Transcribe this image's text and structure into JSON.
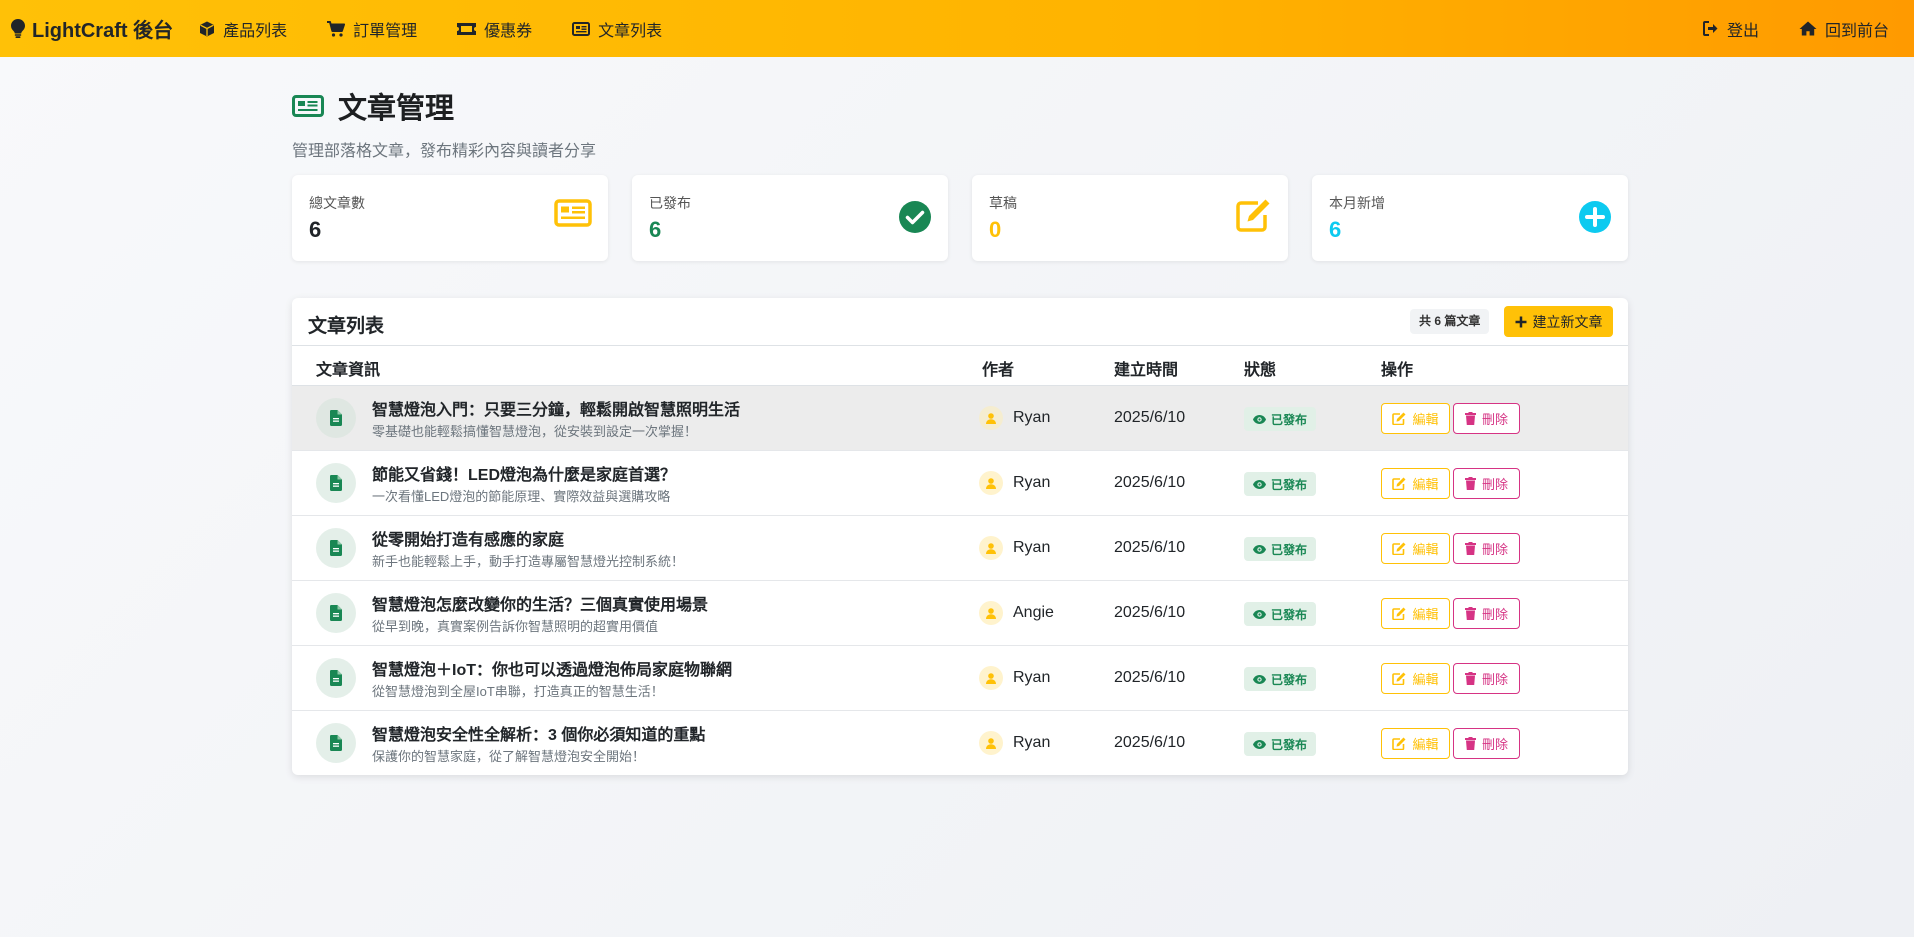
{
  "nav": {
    "brand": "LightCraft 後台",
    "left": [
      {
        "label": "產品列表",
        "icon": "box-icon"
      },
      {
        "label": "訂單管理",
        "icon": "cart-icon"
      },
      {
        "label": "優惠券",
        "icon": "ticket-icon"
      },
      {
        "label": "文章列表",
        "icon": "newspaper-icon"
      }
    ],
    "right": [
      {
        "label": "登出",
        "icon": "logout-icon"
      },
      {
        "label": "回到前台",
        "icon": "home-icon"
      }
    ]
  },
  "header": {
    "title": "文章管理",
    "subtitle": "管理部落格文章，發布精彩內容與讀者分享"
  },
  "stats": [
    {
      "label": "總文章數",
      "value": "6",
      "color": "#212529",
      "icon": "newspaper-icon",
      "icon_color": "#ffc107"
    },
    {
      "label": "已發布",
      "value": "6",
      "color": "#198754",
      "icon": "check-circle-icon",
      "icon_color": "#198754"
    },
    {
      "label": "草稿",
      "value": "0",
      "color": "#ffc107",
      "icon": "edit-icon",
      "icon_color": "#ffc107"
    },
    {
      "label": "本月新增",
      "value": "6",
      "color": "#0dcaf0",
      "icon": "plus-circle-icon",
      "icon_color": "#0dcaf0"
    }
  ],
  "list": {
    "title": "文章列表",
    "count_badge": "共 6 篇文章",
    "new_button": "建立新文章",
    "columns": [
      "文章資訊",
      "作者",
      "建立時間",
      "狀態",
      "操作"
    ],
    "rows": [
      {
        "title": "智慧燈泡入門：只要三分鐘，輕鬆開啟智慧照明生活",
        "desc": "零基礎也能輕鬆搞懂智慧燈泡，從安裝到設定一次掌握！",
        "author": "Ryan",
        "date": "2025/6/10",
        "status": "已發布"
      },
      {
        "title": "節能又省錢！LED燈泡為什麼是家庭首選？",
        "desc": "一次看懂LED燈泡的節能原理、實際效益與選購攻略",
        "author": "Ryan",
        "date": "2025/6/10",
        "status": "已發布"
      },
      {
        "title": "從零開始打造有感應的家庭",
        "desc": "新手也能輕鬆上手，動手打造專屬智慧燈光控制系統！",
        "author": "Ryan",
        "date": "2025/6/10",
        "status": "已發布"
      },
      {
        "title": "智慧燈泡怎麼改變你的生活？三個真實使用場景",
        "desc": "從早到晚，真實案例告訴你智慧照明的超實用價值",
        "author": "Angie",
        "date": "2025/6/10",
        "status": "已發布"
      },
      {
        "title": "智慧燈泡＋IoT：你也可以透過燈泡佈局家庭物聯網",
        "desc": "從智慧燈泡到全屋IoT串聯，打造真正的智慧生活！",
        "author": "Ryan",
        "date": "2025/6/10",
        "status": "已發布"
      },
      {
        "title": "智慧燈泡安全性全解析：3 個你必須知道的重點",
        "desc": "保護你的智慧家庭，從了解智慧燈泡安全開始！",
        "author": "Ryan",
        "date": "2025/6/10",
        "status": "已發布"
      }
    ],
    "edit_label": "編輯",
    "delete_label": "刪除"
  }
}
